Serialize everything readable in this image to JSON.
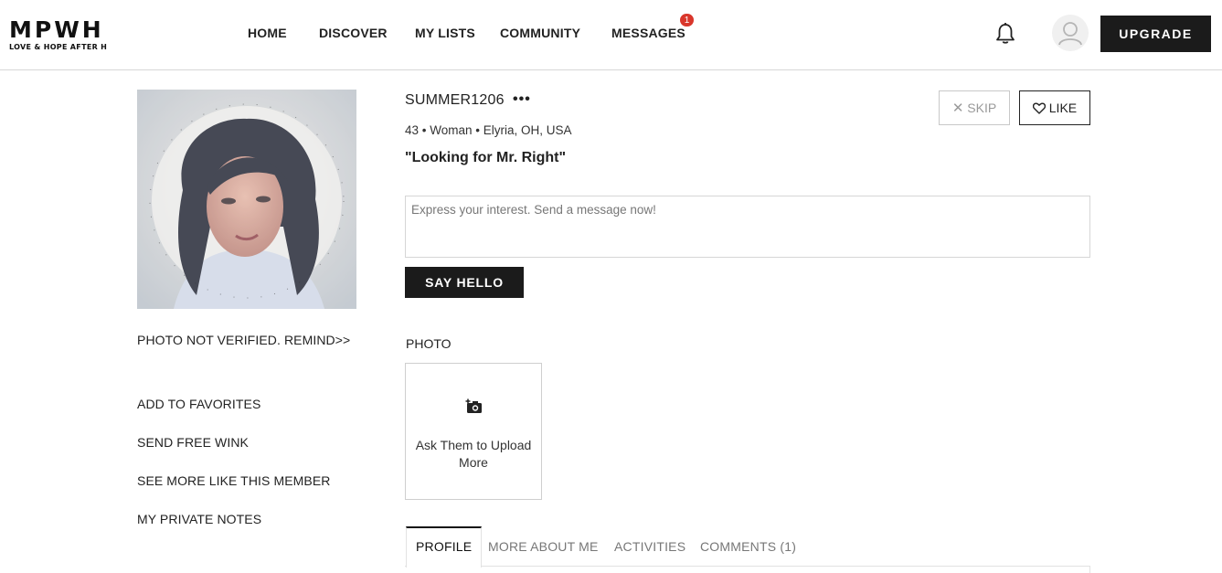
{
  "header": {
    "logo_main": "MPWH",
    "logo_tagline": "LOVE & HOPE AFTER H",
    "nav": [
      {
        "label": "HOME"
      },
      {
        "label": "DISCOVER"
      },
      {
        "label": "MY LISTS"
      },
      {
        "label": "COMMUNITY"
      },
      {
        "label": "MESSAGES"
      }
    ],
    "messages_badge": "1",
    "notification_icon": "bell-icon",
    "avatar_icon": "user-icon",
    "upgrade_label": "UPGRADE"
  },
  "left": {
    "photo_alt": "Profile photo",
    "photo_verify": "PHOTO NOT VERIFIED. REMIND>>",
    "actions": [
      {
        "label": "ADD TO FAVORITES"
      },
      {
        "label": "SEND FREE WINK"
      },
      {
        "label": "SEE MORE LIKE THIS MEMBER"
      },
      {
        "label": "MY PRIVATE NOTES"
      }
    ]
  },
  "profile": {
    "username": "SUMMER1206",
    "more_label": "•••",
    "meta": "43 • Woman • Elyria, OH, USA",
    "headline": "\"Looking for Mr. Right\"",
    "skip_label": "SKIP",
    "like_label": "LIKE",
    "message_placeholder": "Express your interest. Send a message now!",
    "say_hello_label": "SAY HELLO"
  },
  "photos": {
    "title": "PHOTO",
    "upload_text": "Ask Them to Upload More",
    "icon": "add-camera-icon"
  },
  "tabs": [
    {
      "label": "PROFILE",
      "active": true
    },
    {
      "label": "MORE ABOUT ME",
      "active": false
    },
    {
      "label": "ACTIVITIES",
      "active": false
    },
    {
      "label": "COMMENTS (1)",
      "active": false
    }
  ],
  "colors": {
    "badge": "#d9362b",
    "button_dark": "#1b1b1b"
  }
}
